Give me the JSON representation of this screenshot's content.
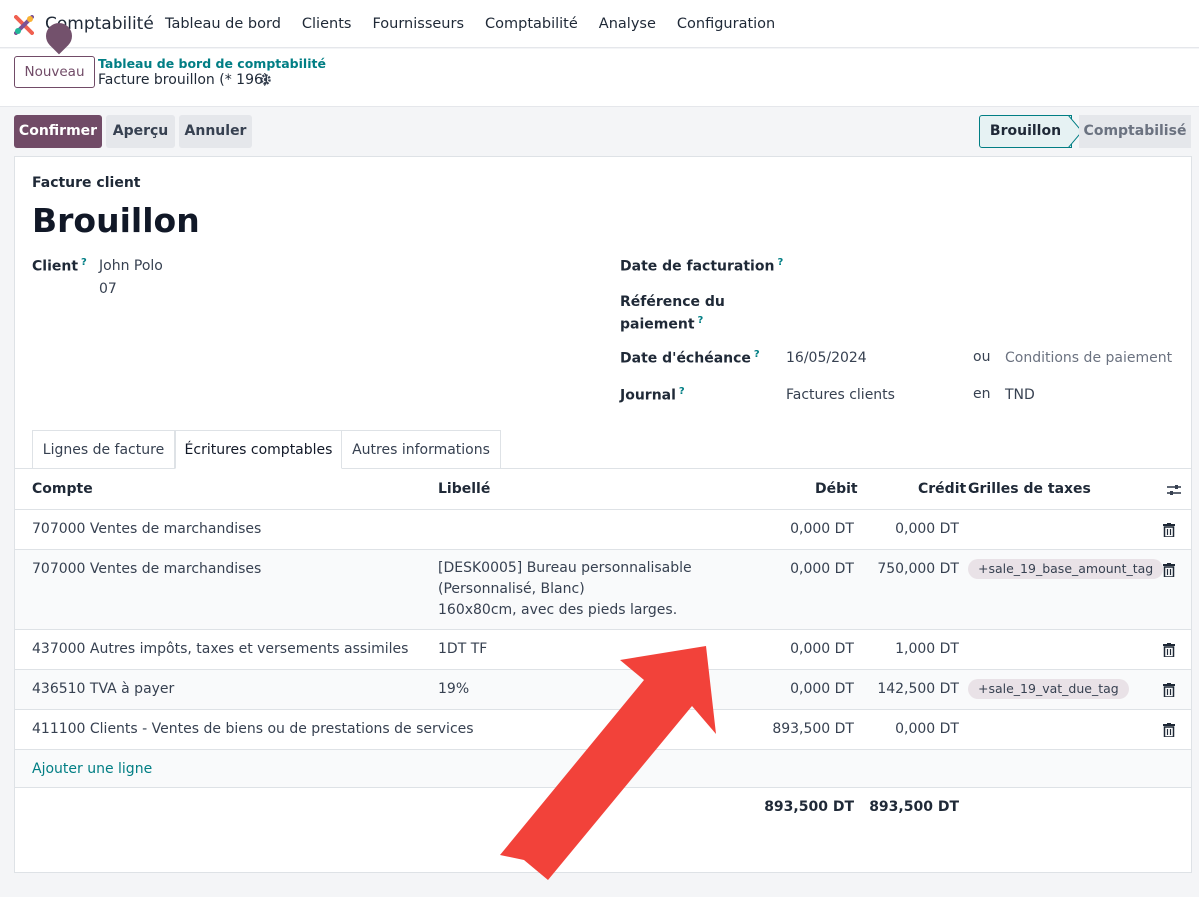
{
  "app": {
    "name": "Comptabilité"
  },
  "nav": {
    "items": [
      "Tableau de bord",
      "Clients",
      "Fournisseurs",
      "Comptabilité",
      "Analyse",
      "Configuration"
    ]
  },
  "control": {
    "new_label": "Nouveau",
    "breadcrumb": "Tableau de bord de comptabilité",
    "record": "Facture brouillon (* 196)"
  },
  "actions": {
    "confirm": "Confirmer",
    "preview": "Aperçu",
    "cancel": "Annuler"
  },
  "status": {
    "current": "Brouillon",
    "next": "Comptabilisé"
  },
  "document": {
    "type": "Facture client",
    "state": "Brouillon"
  },
  "fields": {
    "client_label": "Client",
    "client_name": "John Polo",
    "client_extra": "07",
    "invoice_date_label": "Date de facturation",
    "payment_ref_label_1": "Référence du",
    "payment_ref_label_2": "paiement",
    "due_date_label": "Date d'échéance",
    "due_date": "16/05/2024",
    "or": "ou",
    "payment_terms_placeholder": "Conditions de paiement",
    "journal_label": "Journal",
    "journal": "Factures clients",
    "in": "en",
    "currency": "TND",
    "help": "?"
  },
  "tabs": [
    "Lignes de facture",
    "Écritures comptables",
    "Autres informations"
  ],
  "table": {
    "headers": {
      "account": "Compte",
      "label": "Libellé",
      "debit": "Débit",
      "credit": "Crédit",
      "tax_grids": "Grilles de taxes"
    },
    "rows": [
      {
        "account": "707000 Ventes de marchandises",
        "label": "",
        "label2": "",
        "label3": "",
        "debit": "0,000 DT",
        "credit": "0,000 DT",
        "tag": ""
      },
      {
        "account": "707000 Ventes de marchandises",
        "label": "[DESK0005] Bureau personnalisable",
        "label2": "(Personnalisé, Blanc)",
        "label3": "160x80cm, avec des pieds larges.",
        "debit": "0,000 DT",
        "credit": "750,000 DT",
        "tag": "+sale_19_base_amount_tag"
      },
      {
        "account": "437000 Autres impôts, taxes et versements assimiles",
        "label": "1DT TF",
        "label2": "",
        "label3": "",
        "debit": "0,000 DT",
        "credit": "1,000 DT",
        "tag": ""
      },
      {
        "account": "436510 TVA à payer",
        "label": "19%",
        "label2": "",
        "label3": "",
        "debit": "0,000 DT",
        "credit": "142,500 DT",
        "tag": "+sale_19_vat_due_tag"
      },
      {
        "account": "411100 Clients - Ventes de biens ou de prestations de services",
        "label": "",
        "label2": "",
        "label3": "",
        "debit": "893,500 DT",
        "credit": "0,000 DT",
        "tag": ""
      }
    ],
    "add_line": "Ajouter une ligne",
    "total_debit": "893,500 DT",
    "total_credit": "893,500 DT"
  },
  "colors": {
    "brand": "#714b67",
    "link": "#017e84",
    "annotation_arrow": "#f2423a"
  }
}
